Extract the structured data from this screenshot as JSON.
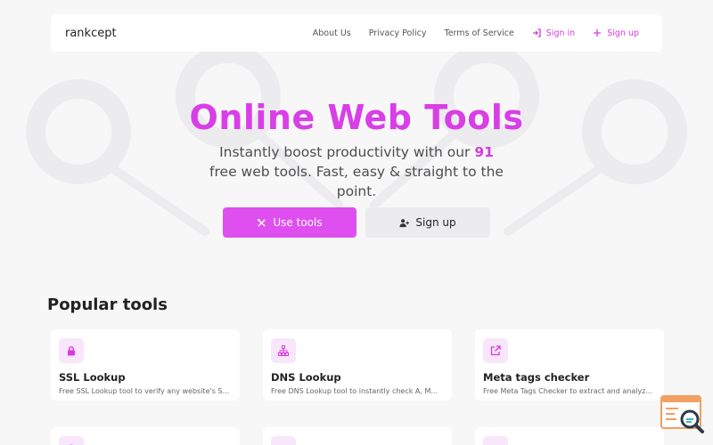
{
  "brand": "rankcept",
  "nav": {
    "about": "About Us",
    "privacy": "Privacy Policy",
    "terms": "Terms of Service",
    "sign_in": "Sign in",
    "sign_up": "Sign up"
  },
  "hero": {
    "title": "Online Web Tools",
    "sub_before": "Instantly boost productivity with our",
    "count": "91",
    "sub_after": "free web tools. Fast, easy & straight to the point.",
    "use_tools": "Use tools",
    "sign_up": "Sign up"
  },
  "popular": {
    "title": "Popular tools",
    "cards": [
      {
        "name": "SSL Lookup",
        "desc": "Free SSL Lookup tool to verify any website's S...",
        "icon": "lock-icon"
      },
      {
        "name": "DNS Lookup",
        "desc": "Free DNS Lookup tool to instantly check A, M...",
        "icon": "sitemap-icon"
      },
      {
        "name": "Meta tags checker",
        "desc": "Free Meta Tags Checker to extract and analyz...",
        "icon": "external-link-icon"
      }
    ]
  },
  "colors": {
    "accent": "#df4ff0",
    "title": "#d83fe6",
    "background": "#f7f7f8"
  }
}
